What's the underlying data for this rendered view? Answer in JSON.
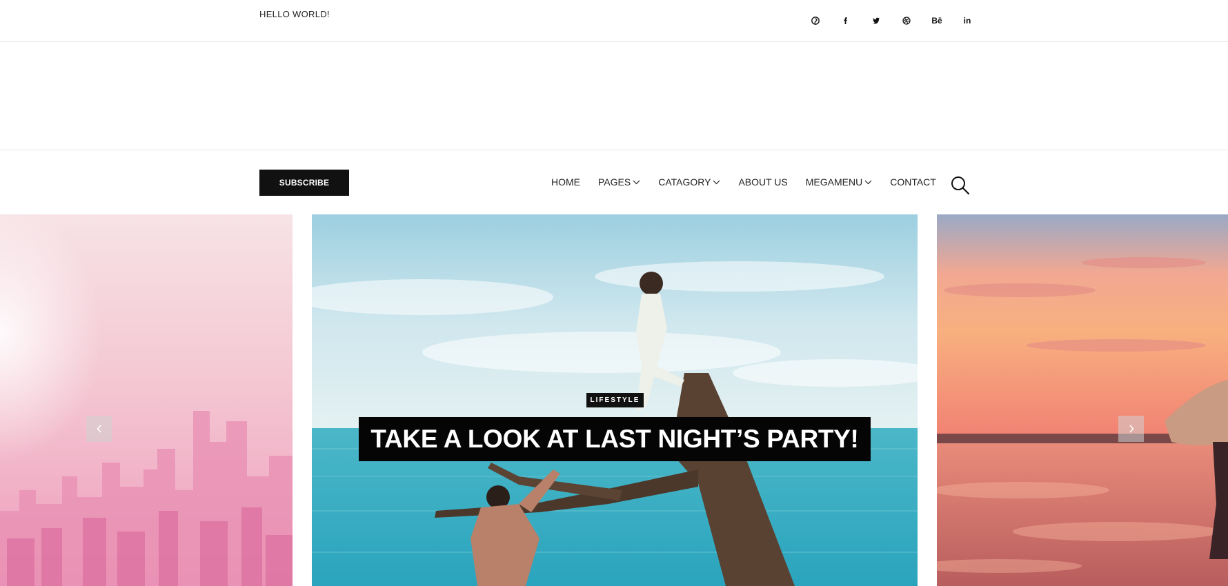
{
  "topbar": {
    "greeting": "HELLO WORLD!",
    "socials": [
      {
        "icon": "pinterest-icon"
      },
      {
        "icon": "facebook-icon"
      },
      {
        "icon": "twitter-icon"
      },
      {
        "icon": "dribbble-icon"
      },
      {
        "icon": "behance-icon",
        "text": "Bē"
      },
      {
        "icon": "linkedin-icon",
        "text": "in"
      }
    ]
  },
  "nav": {
    "subscribe_label": "SUBSCRIBE",
    "items": [
      {
        "label": "HOME",
        "dropdown": false
      },
      {
        "label": "PAGES",
        "dropdown": true
      },
      {
        "label": "CATAGORY",
        "dropdown": true
      },
      {
        "label": "ABOUT US",
        "dropdown": false
      },
      {
        "label": "MEGAMENU",
        "dropdown": true
      },
      {
        "label": "CONTACT",
        "dropdown": false
      }
    ],
    "search_icon": "search-icon"
  },
  "slider": {
    "category": "LIFESTYLE",
    "title": "TAKE A LOOK AT LAST NIGHT’S PARTY!",
    "prev_icon": "chevron-left-icon",
    "next_icon": "chevron-right-icon"
  },
  "colors": {
    "accent": "#111111",
    "left_slide_pink": "#f3b6c9",
    "center_sky": "#bfe0ec",
    "center_sea": "#3fb6c9",
    "right_sunset": "#f39a7f"
  }
}
